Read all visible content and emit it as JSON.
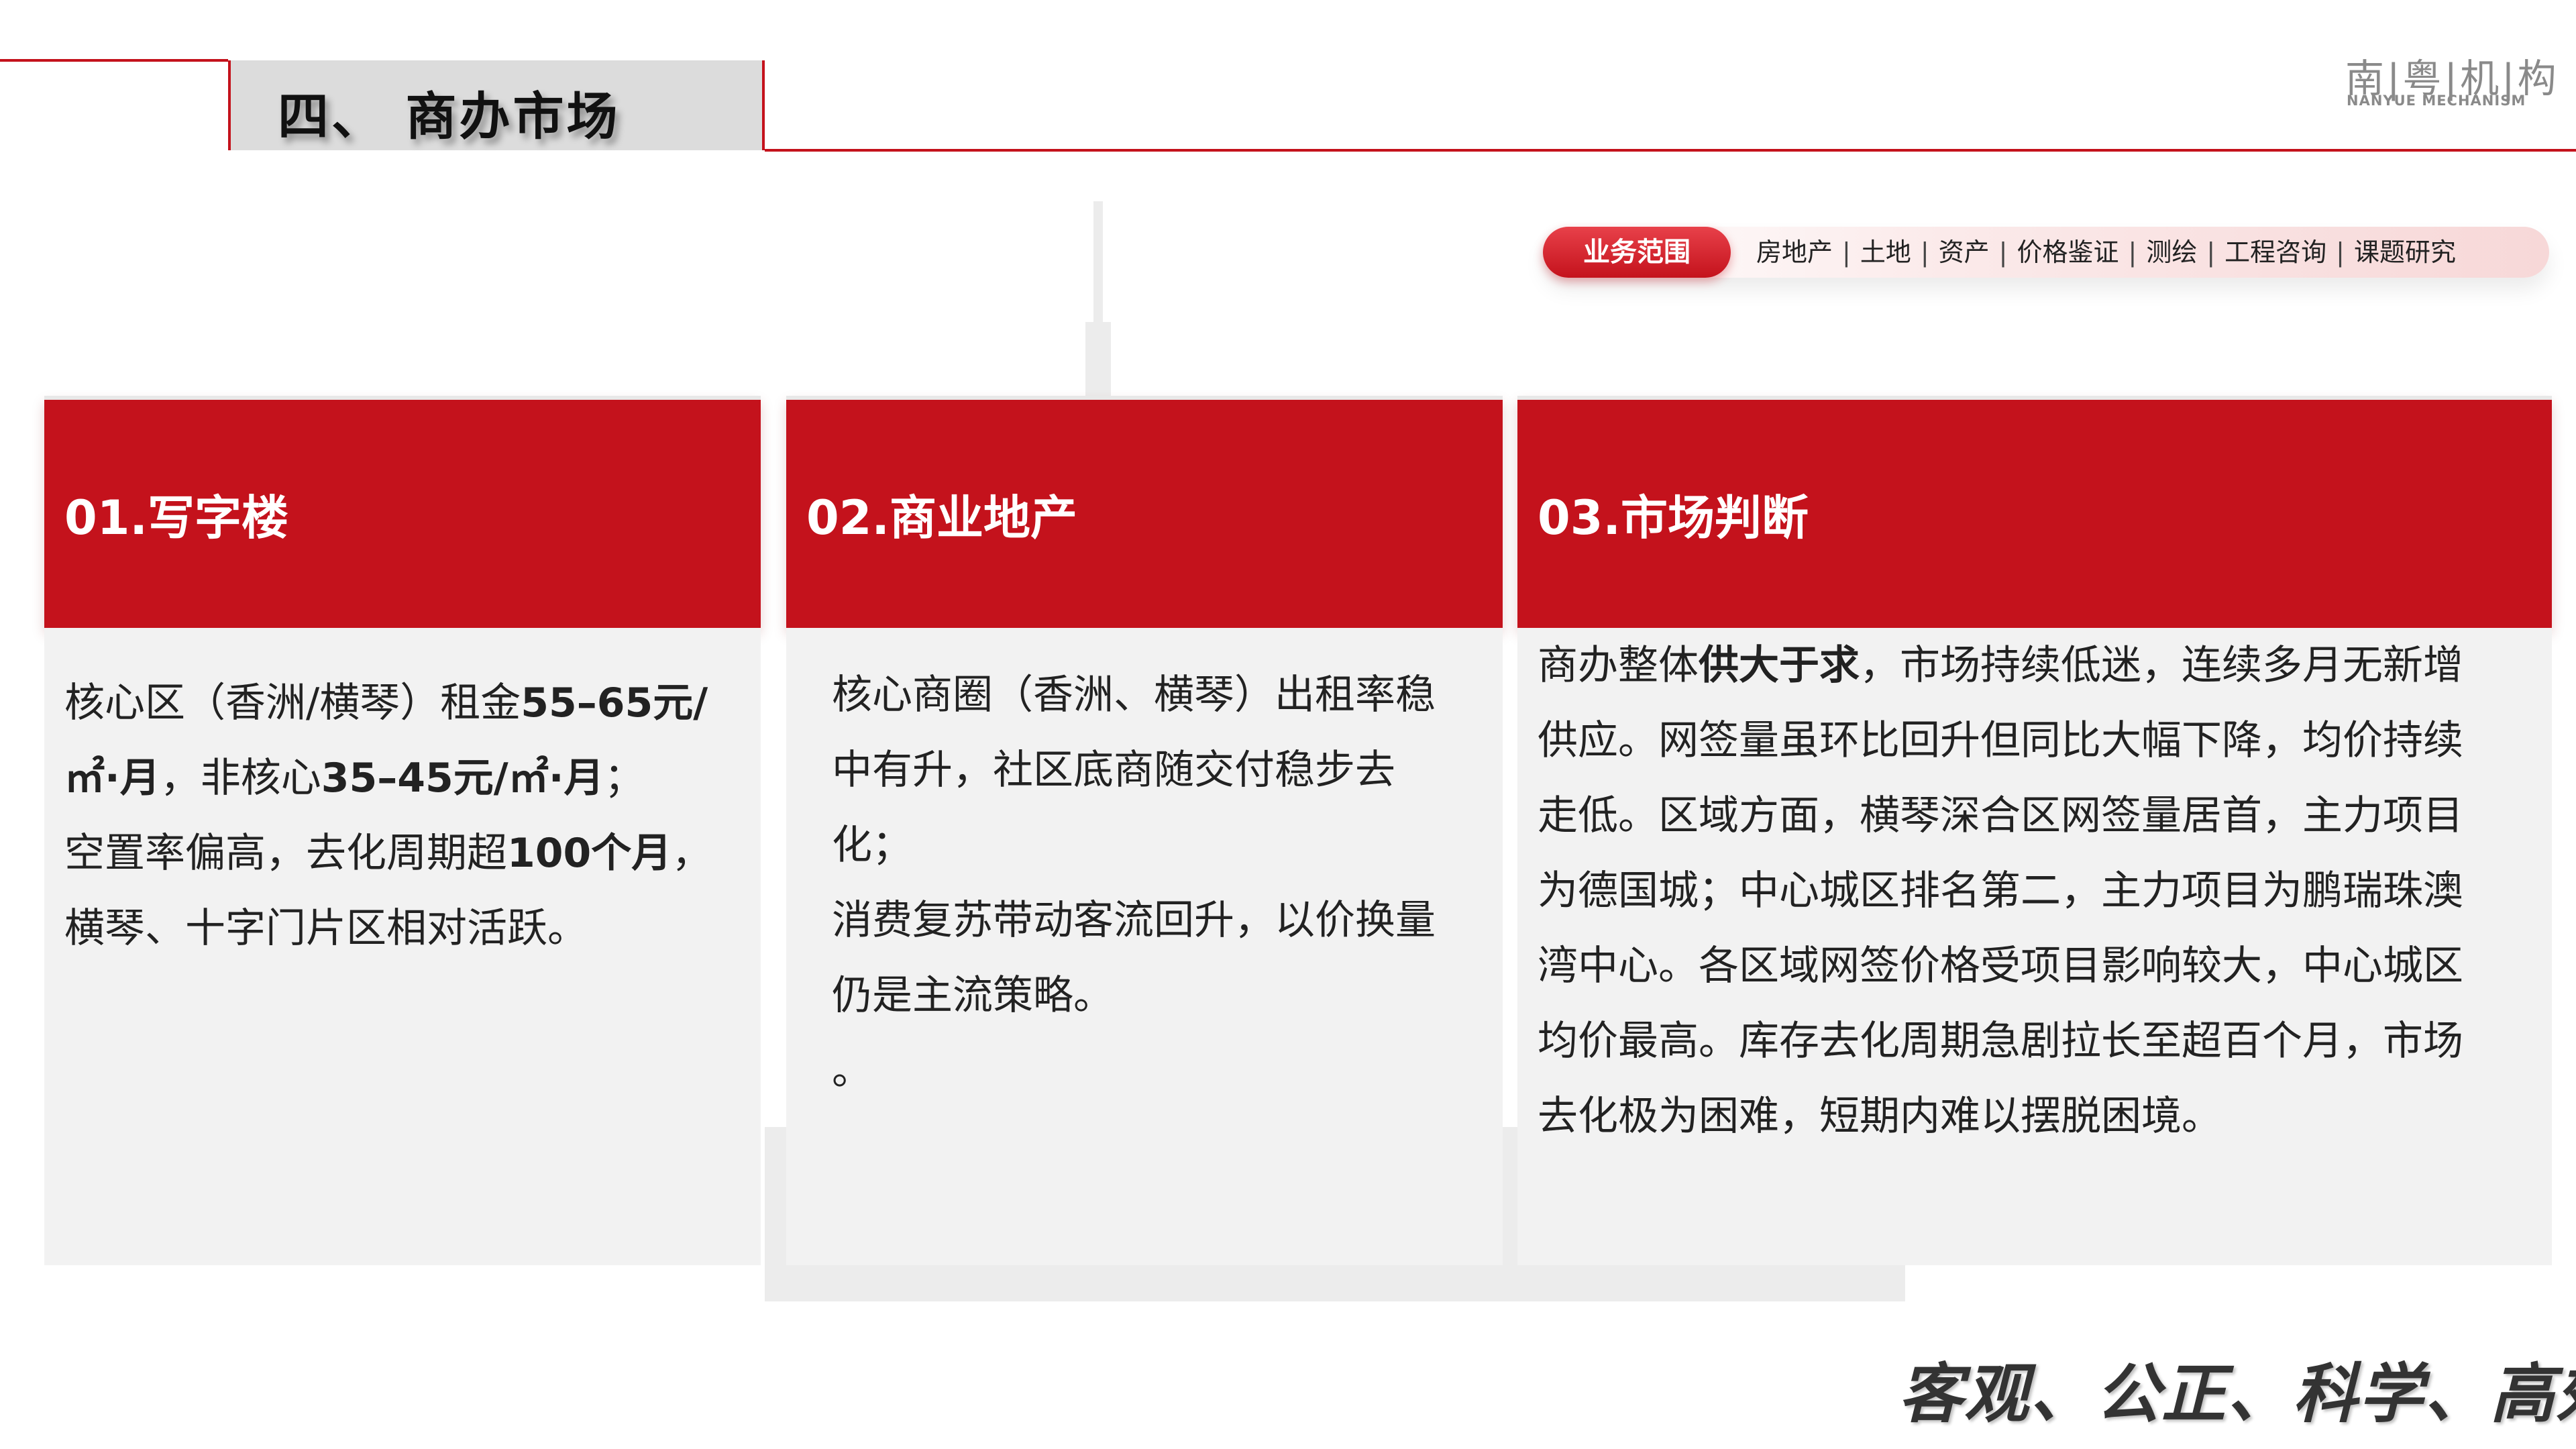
{
  "header": {
    "section_title": "四、 商办市场"
  },
  "logo": {
    "cn": "南|粤|机|构",
    "en": "NANYUE MECHANISM"
  },
  "business": {
    "label": "业务范围",
    "items": [
      "房地产",
      "土地",
      "资产",
      "价格鉴证",
      "测绘",
      "工程咨询",
      "课题研究"
    ],
    "separator": "|"
  },
  "cards": [
    {
      "title": "01.写字楼",
      "paragraphs": [
        [
          {
            "t": "核心区（香洲/横琴）租金",
            "b": false
          },
          {
            "t": "55–65元/㎡·月",
            "b": true
          },
          {
            "t": "，非核心",
            "b": false
          },
          {
            "t": "35–45元/㎡·月",
            "b": true
          },
          {
            "t": "；",
            "b": false
          }
        ],
        [
          {
            "t": "空置率偏高，去化周期超",
            "b": false
          },
          {
            "t": "100个月",
            "b": true
          },
          {
            "t": "，横琴、十字门片区相对活跃。",
            "b": false
          }
        ]
      ]
    },
    {
      "title": "02.商业地产",
      "paragraphs": [
        [
          {
            "t": "核心商圈（香洲、横琴）出租率稳中有升，社区底商随交付稳步去化；",
            "b": false
          }
        ],
        [
          {
            "t": "消费复苏带动客流回升，以价换量仍是主流策略。",
            "b": false
          }
        ],
        [
          {
            "t": "。",
            "b": false
          }
        ]
      ]
    },
    {
      "title": "03.市场判断",
      "paragraphs": [
        [
          {
            "t": "商办整体",
            "b": false
          },
          {
            "t": "供大于求",
            "b": true
          },
          {
            "t": "，市场持续低迷，连续多月无新增供应。网签量虽环比回升但同比大幅下降，均价持续走低。区域方面，横琴深合区网签量居首，主力项目为德国城；中心城区排名第二，主力项目为鹏瑞珠澳湾中心。各区域网签价格受项目影响较大，中心城区均价最高。库存去化周期急剧拉长至超百个月，市场去化极为困难，短期内难以摆脱困境。",
            "b": false
          }
        ]
      ]
    }
  ],
  "slogan": "客观、公正、科学、高效",
  "colors": {
    "brand_red": "#c4121c",
    "panel_gray": "#f2f2f2",
    "title_gray": "#dcdcdc"
  }
}
